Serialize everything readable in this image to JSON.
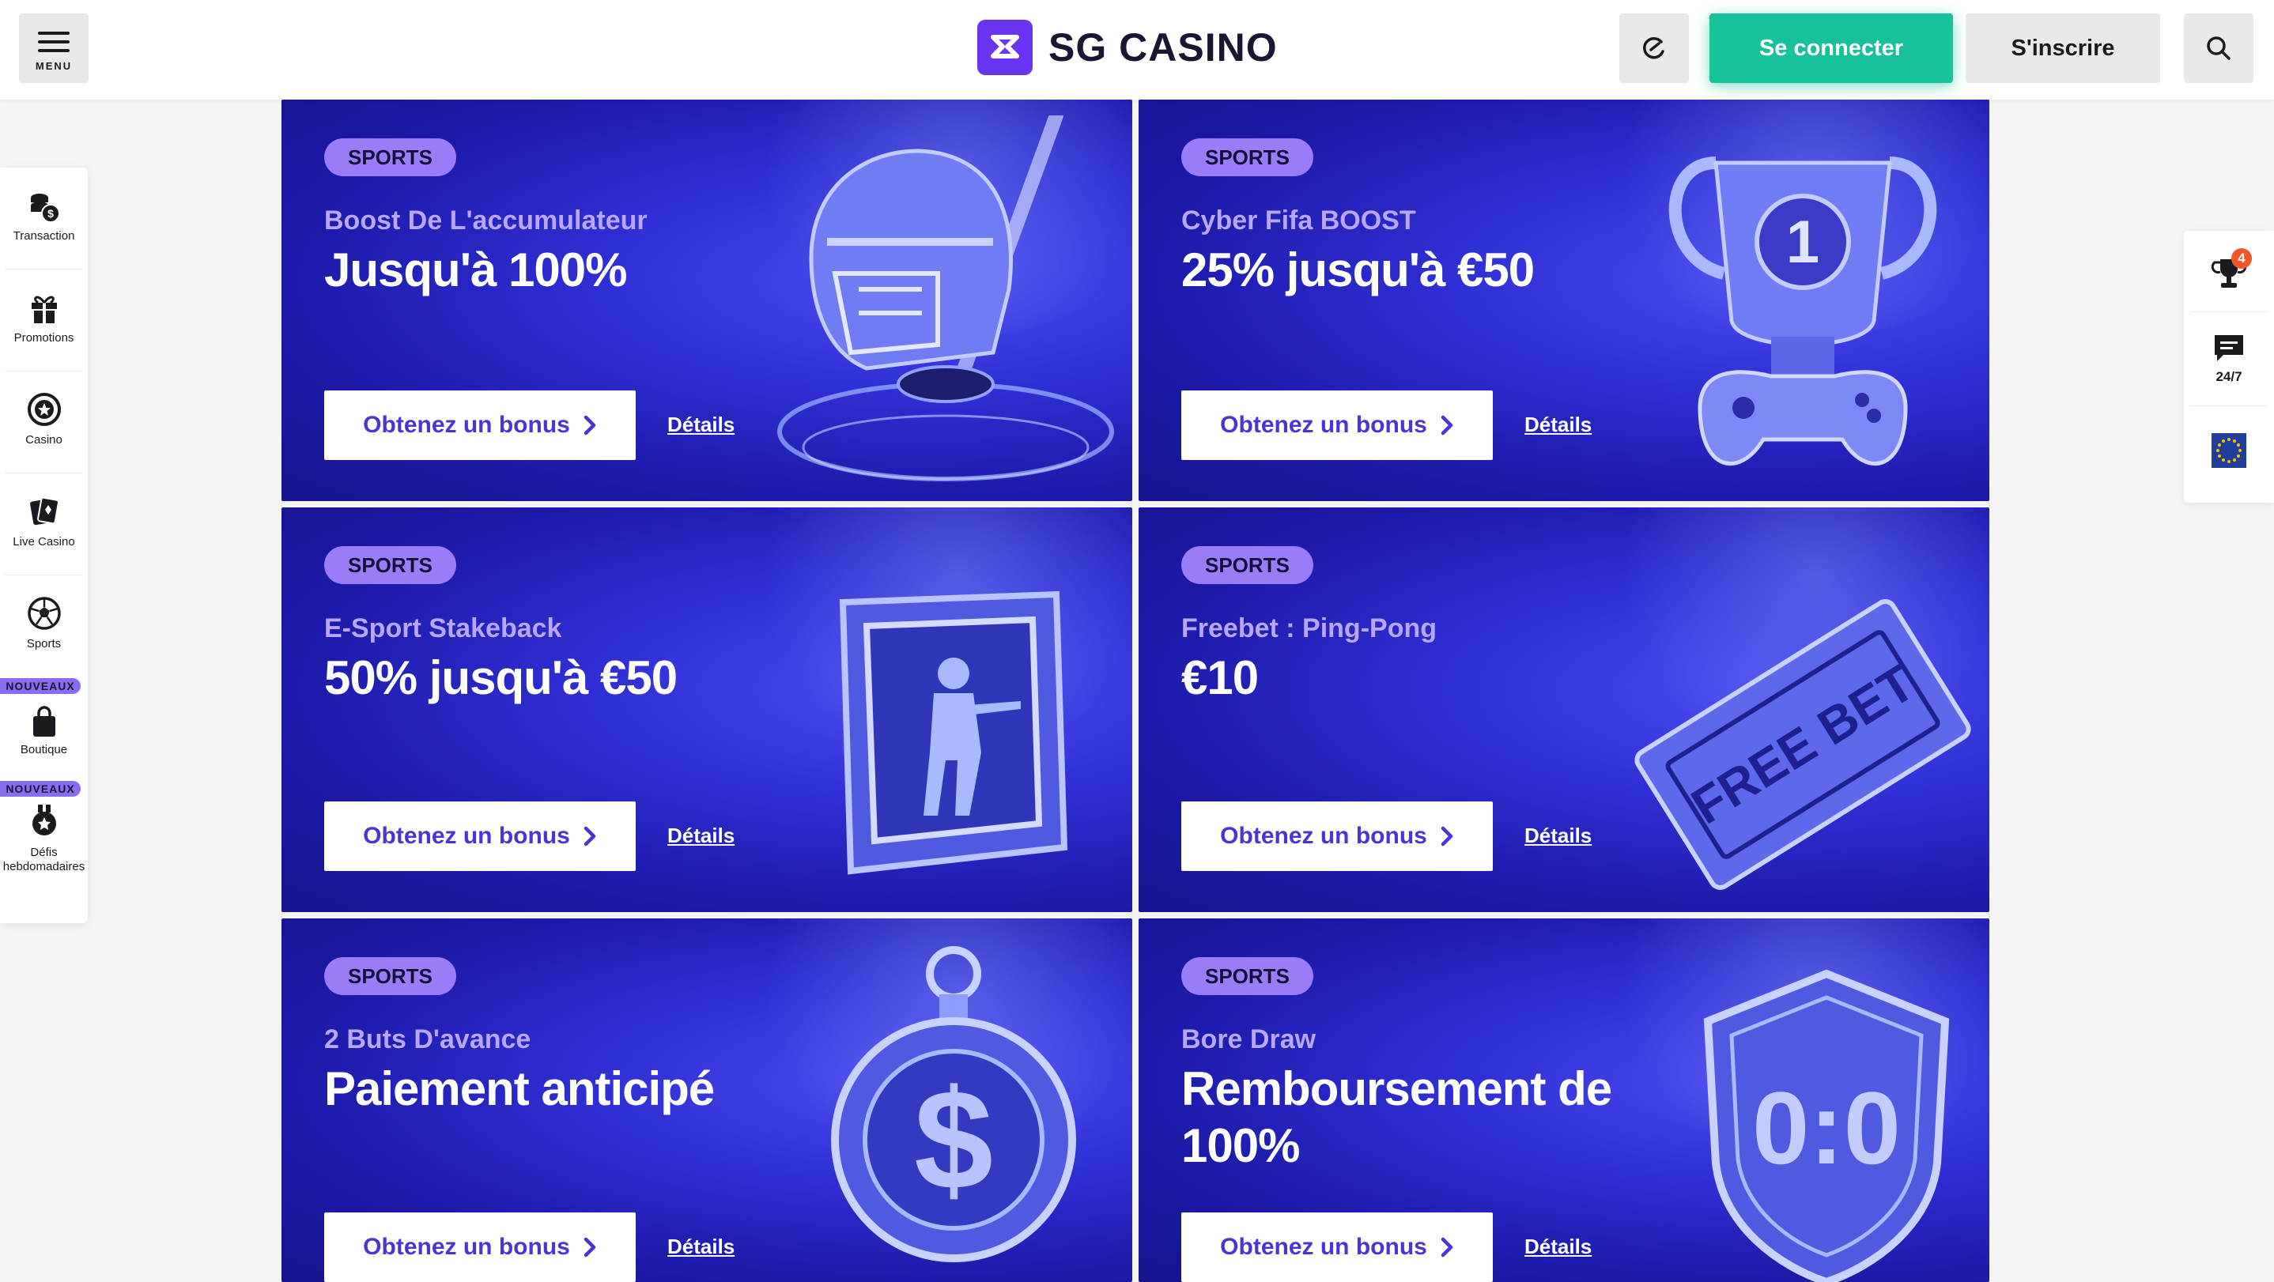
{
  "header": {
    "menu_label": "MENU",
    "logo_text": "SG CASINO",
    "login_label": "Se connecter",
    "register_label": "S'inscrire"
  },
  "sidebar": {
    "items": [
      {
        "label": "Transaction",
        "icon": "coins-icon"
      },
      {
        "label": "Promotions",
        "icon": "gift-icon"
      },
      {
        "label": "Casino",
        "icon": "casino-chip-icon"
      },
      {
        "label": "Live Casino",
        "icon": "cards-icon"
      },
      {
        "label": "Sports",
        "icon": "football-icon"
      },
      {
        "label": "Boutique",
        "icon": "shopping-bag-icon",
        "badge": "NOUVEAUX"
      },
      {
        "label": "Défis hebdomadaires",
        "icon": "medal-icon",
        "badge": "NOUVEAUX"
      }
    ]
  },
  "rightbar": {
    "trophy_count": "4",
    "chat_label": "24/7",
    "icons": [
      "trophy-icon",
      "chat-icon",
      "eu-flag-icon"
    ]
  },
  "promos": [
    {
      "tag": "SPORTS",
      "subtitle": "Boost De L'accumulateur",
      "title": "Jusqu'à 100%",
      "button": "Obtenez un bonus",
      "link": "Détails",
      "art": "hockey-helmet-icon"
    },
    {
      "tag": "SPORTS",
      "subtitle": "Cyber Fifa BOOST",
      "title": "25% jusqu'à €50",
      "button": "Obtenez un bonus",
      "link": "Détails",
      "art": "trophy-gamepad-icon"
    },
    {
      "tag": "SPORTS",
      "subtitle": "E-Sport Stakeback",
      "title": "50% jusqu'à €50",
      "button": "Obtenez un bonus",
      "link": "Détails",
      "art": "esport-soldier-icon"
    },
    {
      "tag": "SPORTS",
      "subtitle": "Freebet : Ping-Pong",
      "title": "€10",
      "button": "Obtenez un bonus",
      "link": "Détails",
      "art": "free-bet-ticket-icon",
      "art_text": "FREE BET"
    },
    {
      "tag": "SPORTS",
      "subtitle": "2 Buts D'avance",
      "title": "Paiement anticipé",
      "button": "Obtenez un bonus",
      "link": "Détails",
      "art": "dollar-stopwatch-icon"
    },
    {
      "tag": "SPORTS",
      "subtitle": "Bore Draw",
      "title": "Remboursement de 100%",
      "button": "Obtenez un bonus",
      "link": "Détails",
      "art": "score-shield-icon",
      "art_text": "0:0"
    }
  ],
  "colors": {
    "accent_green": "#17c29b",
    "brand_purple": "#6a35f2",
    "card_blue": "#2f2fd6",
    "tag_purple": "#9a7cf7"
  }
}
